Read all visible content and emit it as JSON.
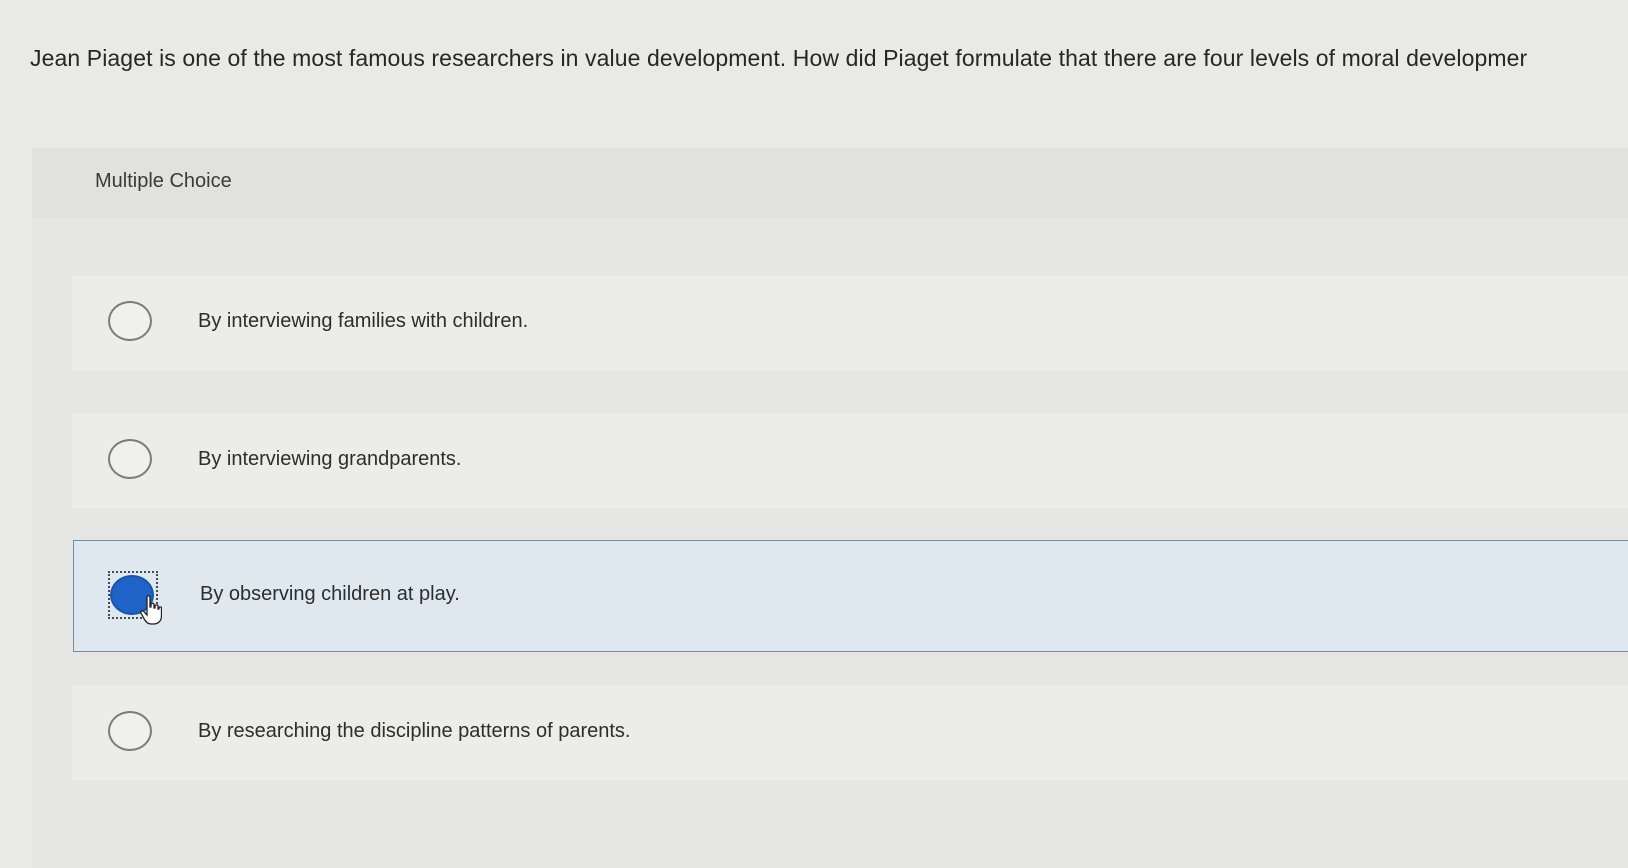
{
  "question": {
    "text": "Jean Piaget is one of the most famous researchers in value development. How did Piaget formulate that there are four levels of moral developmer"
  },
  "panel": {
    "label": "Multiple Choice"
  },
  "options": [
    {
      "text": "By interviewing families with children.",
      "selected": false
    },
    {
      "text": "By interviewing grandparents.",
      "selected": false
    },
    {
      "text": "By observing children at play.",
      "selected": true
    },
    {
      "text": "By researching the discipline patterns of parents.",
      "selected": false
    }
  ],
  "colors": {
    "selected_radio": "#1f63c7",
    "selected_border": "#6f8fa6",
    "selected_background": "#dfe8ee"
  }
}
